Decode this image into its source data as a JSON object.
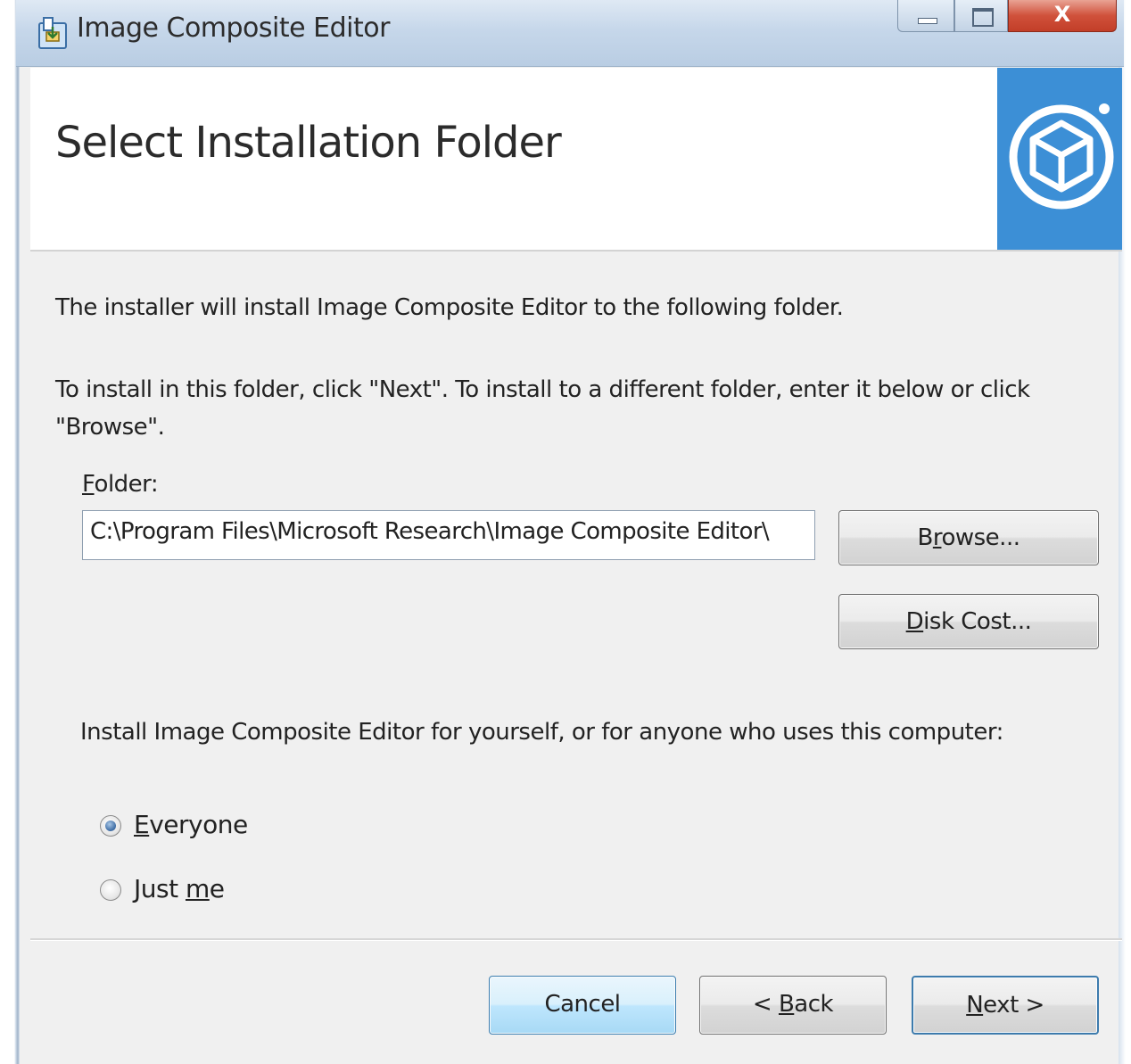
{
  "window": {
    "title": "Image Composite Editor",
    "close_glyph": "X"
  },
  "header": {
    "title": "Select Installation Folder",
    "logo_icon": "installer-package-icon",
    "logo_color": "#3c8fd6"
  },
  "content": {
    "intro": "The installer will install Image Composite Editor to the following folder.",
    "instructions": "To install in this folder, click \"Next\". To install to a different folder, enter it below or click \"Browse\".",
    "folder_label_mnemonic": "F",
    "folder_label_rest": "older:",
    "folder_value": "C:\\Program Files\\Microsoft Research\\Image Composite Editor\\",
    "browse_pre": "B",
    "browse_mnemonic": "r",
    "browse_post": "owse...",
    "disk_mnemonic": "D",
    "disk_post": "isk Cost...",
    "install_for": "Install Image Composite Editor for yourself, or for anyone who uses this computer:",
    "options": [
      {
        "mnemonic": "E",
        "rest": "veryone",
        "selected": true
      },
      {
        "pre": "Just ",
        "mnemonic": "m",
        "rest": "e",
        "selected": false
      }
    ]
  },
  "footer": {
    "cancel_label": "Cancel",
    "back_pre": "< ",
    "back_mnemonic": "B",
    "back_post": "ack",
    "next_mnemonic": "N",
    "next_post": "ext >"
  }
}
